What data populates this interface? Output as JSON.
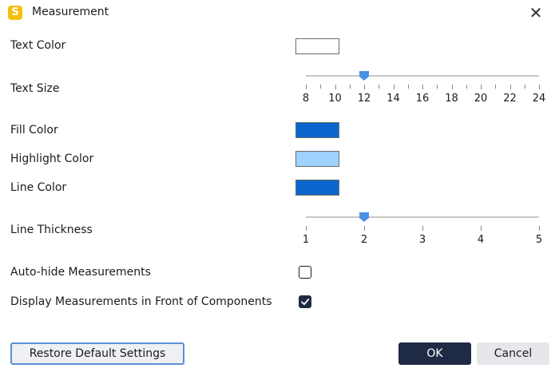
{
  "window": {
    "title": "Measurement",
    "app_icon_glyph": "S",
    "app_icon_color": "#F6C10D",
    "close_glyph": "✕"
  },
  "settings": {
    "text_color": {
      "label": "Text Color",
      "value": "#FFFFFF"
    },
    "text_size": {
      "label": "Text Size",
      "min": 8,
      "max": 24,
      "value": 12,
      "tick_labels": [
        "8",
        "10",
        "12",
        "14",
        "16",
        "18",
        "20",
        "22",
        "24"
      ]
    },
    "fill_color": {
      "label": "Fill Color",
      "value": "#0A66CC"
    },
    "highlight_color": {
      "label": "Highlight Color",
      "value": "#9ED2FF"
    },
    "line_color": {
      "label": "Line Color",
      "value": "#0A66CC"
    },
    "line_thickness": {
      "label": "Line Thickness",
      "min": 1,
      "max": 5,
      "value": 2,
      "tick_labels": [
        "1",
        "2",
        "3",
        "4",
        "5"
      ]
    },
    "auto_hide": {
      "label": "Auto-hide Measurements",
      "checked": false
    },
    "display_front": {
      "label": "Display Measurements in Front of Components",
      "checked": true
    }
  },
  "buttons": {
    "restore": "Restore Default Settings",
    "ok": "OK",
    "cancel": "Cancel"
  },
  "colors": {
    "slider_thumb": "#4A90E2",
    "primary": "#1F2A44",
    "focus_border": "#5B8FD6"
  }
}
